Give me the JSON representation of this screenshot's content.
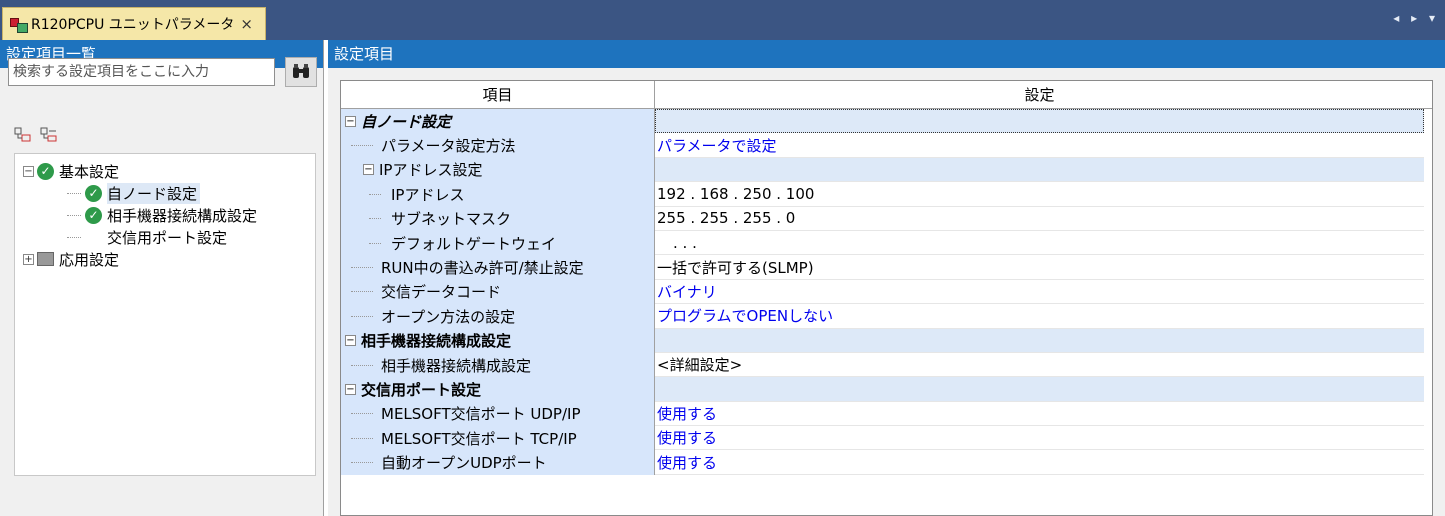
{
  "tab": {
    "title": "R120PCPU ユニットパラメータ",
    "close": "×",
    "nav": "◂ ▸ ▾"
  },
  "left_panel": {
    "header": "設定項目一覧",
    "search_placeholder": "検索する設定項目をここに入力",
    "search_icon": "binoculars-icon",
    "tree": [
      {
        "label": "基本設定",
        "expander": "−"
      },
      {
        "label": "自ノード設定"
      },
      {
        "label": "相手機器接続構成設定"
      },
      {
        "label": "交信用ポート設定"
      },
      {
        "label": "応用設定",
        "expander": "+"
      }
    ]
  },
  "right_panel": {
    "header": "設定項目",
    "columns": {
      "item": "項目",
      "setting": "設定"
    },
    "rows": [
      {
        "item": "自ノード設定",
        "value": ""
      },
      {
        "item": "パラメータ設定方法",
        "value": "パラメータで設定"
      },
      {
        "item": "IPアドレス設定",
        "value": ""
      },
      {
        "item": "IPアドレス",
        "value": "192 . 168 . 250 . 100"
      },
      {
        "item": "サブネットマスク",
        "value": "255 . 255 . 255 .   0"
      },
      {
        "item": "デフォルトゲートウェイ",
        "value": ".       .       ."
      },
      {
        "item": "RUN中の書込み許可/禁止設定",
        "value": "一括で許可する(SLMP)"
      },
      {
        "item": "交信データコード",
        "value": "バイナリ"
      },
      {
        "item": "オープン方法の設定",
        "value": "プログラムでOPENしない"
      },
      {
        "item": "相手機器接続構成設定",
        "value": ""
      },
      {
        "item": "相手機器接続構成設定",
        "value": "<詳細設定>"
      },
      {
        "item": "交信用ポート設定",
        "value": ""
      },
      {
        "item": "MELSOFT交信ポート UDP/IP",
        "value": "使用する"
      },
      {
        "item": "MELSOFT交信ポート TCP/IP",
        "value": "使用する"
      },
      {
        "item": "自動オープンUDPポート",
        "value": "使用する"
      }
    ]
  },
  "colors": {
    "header_blue": "#1e73be",
    "tabbar": "#3b5583",
    "tab_active": "#f5e7a8",
    "item_col": "#d7e6fb",
    "value_blue": "#0000ee"
  }
}
